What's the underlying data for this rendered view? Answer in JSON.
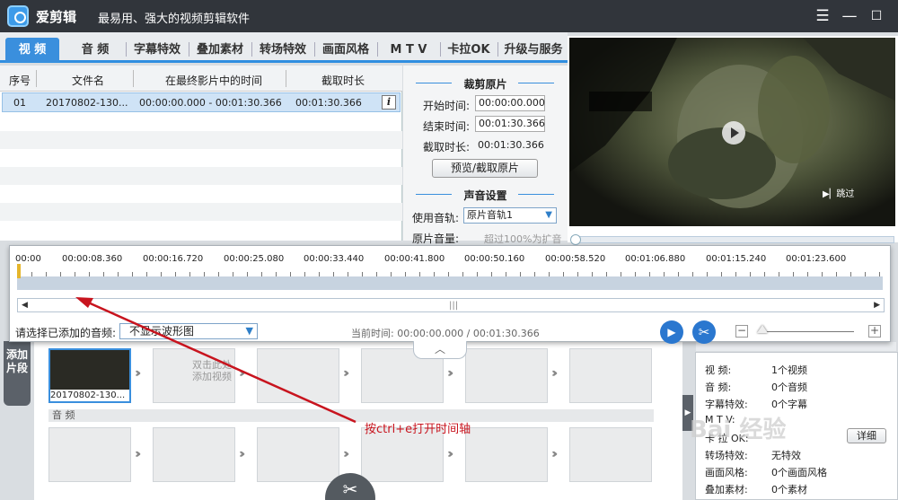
{
  "app": {
    "name": "爱剪辑",
    "slogan": "最易用、强大的视频剪辑软件"
  },
  "window_controls": {
    "menu": "☰",
    "minimize": "—",
    "maximize": "☐",
    "close": "✕"
  },
  "tabs": [
    "视 频",
    "音 频",
    "字幕特效",
    "叠加素材",
    "转场特效",
    "画面风格",
    "M T V",
    "卡拉OK",
    "升级与服务"
  ],
  "file_list": {
    "columns": [
      "序号",
      "文件名",
      "在最终影片中的时间",
      "截取时长"
    ],
    "rows": [
      {
        "index": "01",
        "filename": "20170802-130...",
        "time_range": "00:00:00.000 - 00:01:30.366",
        "duration": "00:01:30.366"
      }
    ],
    "info_icon": "i"
  },
  "crop_panel": {
    "title": "裁剪原片",
    "start_label": "开始时间:",
    "start_value": "00:00:00.000",
    "end_label": "结束时间:",
    "end_value": "00:01:30.366",
    "duration_label": "截取时长:",
    "duration_value": "00:01:30.366",
    "preview_button": "预览/截取原片"
  },
  "sound_panel": {
    "title": "声音设置",
    "track_label": "使用音轨:",
    "track_value": "原片音轨1",
    "volume_label": "原片音量:",
    "volume_hint": "超过100%为扩音"
  },
  "preview": {
    "skip_label": "跳过"
  },
  "timeline": {
    "ticks": [
      "00:00",
      "00:00:08.360",
      "00:00:16.720",
      "00:00:25.080",
      "00:00:33.440",
      "00:00:41.800",
      "00:00:50.160",
      "00:00:58.520",
      "00:01:06.880",
      "00:01:15.240",
      "00:01:23.600"
    ],
    "audio_select_label": "请选择已添加的音频:",
    "waveform_option": "不显示波形图",
    "current_time_label": "当前时间:",
    "current_time": "00:00:00.000",
    "total_time": "00:01:30.366",
    "play_progress": 0.0
  },
  "add_clip_tab": "添加片段",
  "clips": {
    "clip_name": "20170802-130...",
    "empty_hint_line1": "双击此处",
    "empty_hint_line2": "添加视频",
    "audio_section": "音 频"
  },
  "stats": {
    "rows": [
      {
        "key": "视    频:",
        "value": "1个视频"
      },
      {
        "key": "音    频:",
        "value": "0个音频"
      },
      {
        "key": "字幕特效:",
        "value": "0个字幕"
      },
      {
        "key": "M  T  V:",
        "value": ""
      },
      {
        "key": "卡 拉 OK:",
        "value": ""
      },
      {
        "key": "转场特效:",
        "value": "无特效"
      },
      {
        "key": "画面风格:",
        "value": "0个画面风格"
      },
      {
        "key": "叠加素材:",
        "value": "0个素材"
      }
    ],
    "detail_button": "详细"
  },
  "annotation": "按ctrl+e打开时间轴",
  "watermark": "Bai 经验",
  "colors": {
    "accent": "#2f8ee0",
    "play_button": "#2a77cf",
    "annotation": "#c8141e",
    "titlebar": "#31353b"
  }
}
